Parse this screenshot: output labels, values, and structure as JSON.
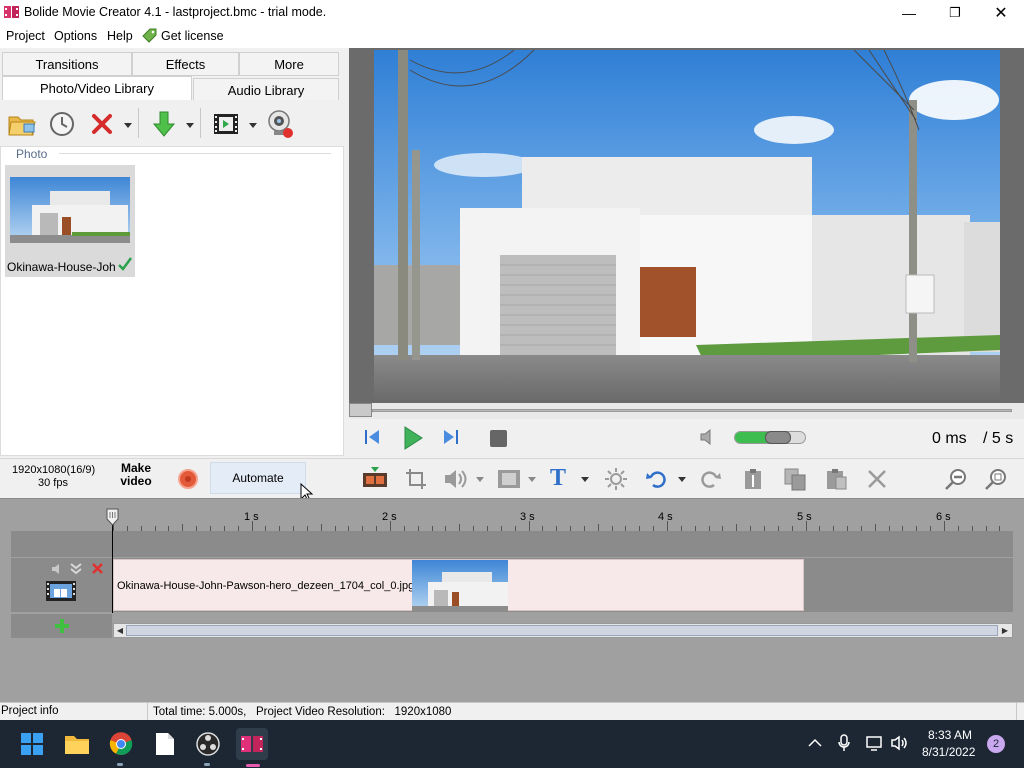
{
  "window": {
    "title": "Bolide Movie Creator 4.1 - lastproject.bmc  - trial mode.",
    "minimize": "—",
    "maximize": "❐",
    "close": "✕"
  },
  "menu": {
    "items": [
      "Project",
      "Options",
      "Help"
    ],
    "license": "Get license"
  },
  "tabs": {
    "top": [
      "Transitions",
      "Effects",
      "More"
    ],
    "bottom": [
      "Photo/Video Library",
      "Audio Library"
    ]
  },
  "library": {
    "section": "Photo",
    "item_name": "Okinawa-House-Joh"
  },
  "player": {
    "time_current": "0 ms",
    "time_total": "/ 5 s",
    "volume_pct": 80
  },
  "project": {
    "resolution": "1920x1080(16/9)",
    "fps": "30 fps",
    "make_video_line1": "Make",
    "make_video_line2": "video",
    "automate": "Automate"
  },
  "timeline": {
    "ticks": [
      "1 s",
      "2 s",
      "3 s",
      "4 s",
      "5 s",
      "6 s"
    ],
    "clip_name": "Okinawa-House-John-Pawson-hero_dezeen_1704_col_0.jpg"
  },
  "status": {
    "project_info": "Project info",
    "total_time": "Total time: 5.000s,",
    "video_resolution": "Project Video Resolution:   1920x1080"
  },
  "taskbar": {
    "time": "8:33 AM",
    "date": "8/31/2022",
    "notification_count": "2"
  },
  "colors": {
    "accent": "#2f6fc9",
    "play_green": "#2fa84a",
    "clip_bg": "#f7e9e9",
    "taskbar": "#1c2733"
  }
}
